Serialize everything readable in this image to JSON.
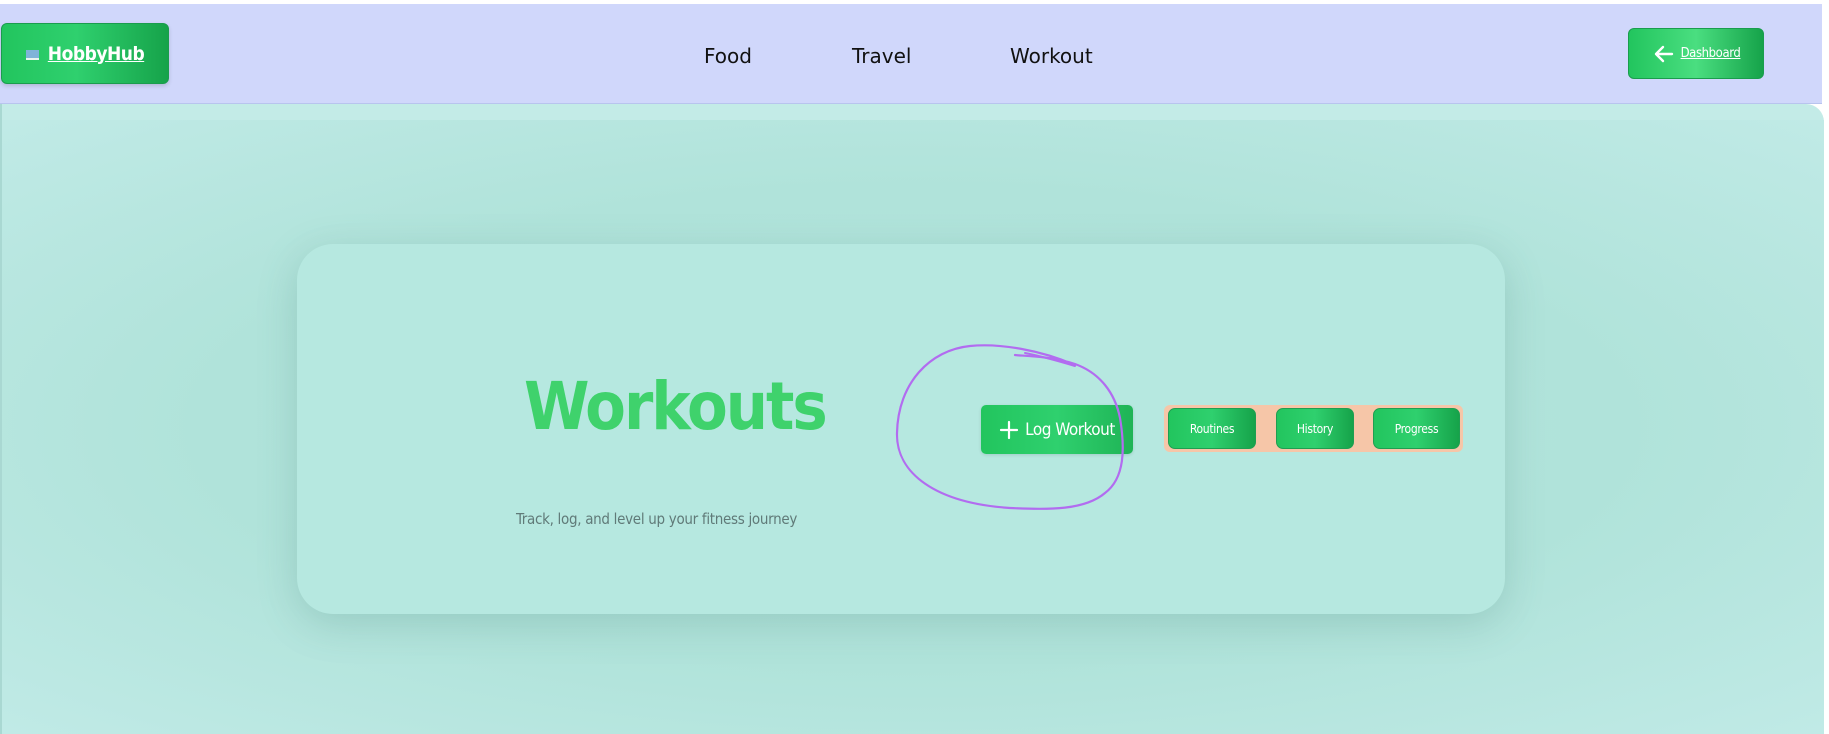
{
  "header": {
    "brand": {
      "label": "HobbyHub",
      "icon": "laptop-icon"
    },
    "nav": [
      {
        "label": "Food"
      },
      {
        "label": "Travel"
      },
      {
        "label": "Workout"
      }
    ],
    "dashboard_button": {
      "label": "Dashboard",
      "icon": "arrow-left-icon"
    }
  },
  "hero": {
    "title": "Workouts",
    "subtitle": "Track, log, and level up your fitness journey",
    "log_button": {
      "label": "Log Workout",
      "icon": "plus-icon"
    },
    "tabs": [
      {
        "label": "Routines"
      },
      {
        "label": "History"
      },
      {
        "label": "Progress"
      }
    ]
  },
  "colors": {
    "header_bg": "#d0d7fb",
    "accent_green": "#22c55e",
    "title_green": "#3fd26c",
    "tab_group_bg": "#f6c6a8",
    "annotation_stroke": "#b26cf0",
    "page_bg": "#c3ebe7"
  }
}
